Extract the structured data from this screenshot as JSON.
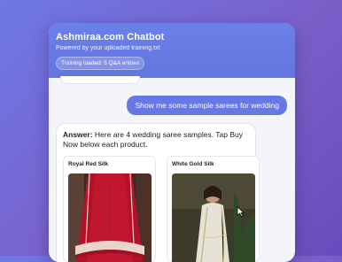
{
  "header": {
    "title": "Ashmiraa.com Chatbot",
    "subtitle": "Powered by your uploaded training.txt",
    "badge": "Training loaded: 5 Q&A entries"
  },
  "chat": {
    "user_message": "Show me some sample sarees for wedding",
    "answer_label": "Answer:",
    "answer_text": " Here are 4 wedding saree samples. Tap Buy Now below each product.",
    "products": [
      {
        "name": "Royal Red Silk"
      },
      {
        "name": "White Gold  Silk"
      }
    ]
  },
  "colors": {
    "accent": "#6678e3",
    "header": "#6a80e8",
    "background": "#7b5fc9"
  },
  "icons": [
    "cursor-icon"
  ]
}
